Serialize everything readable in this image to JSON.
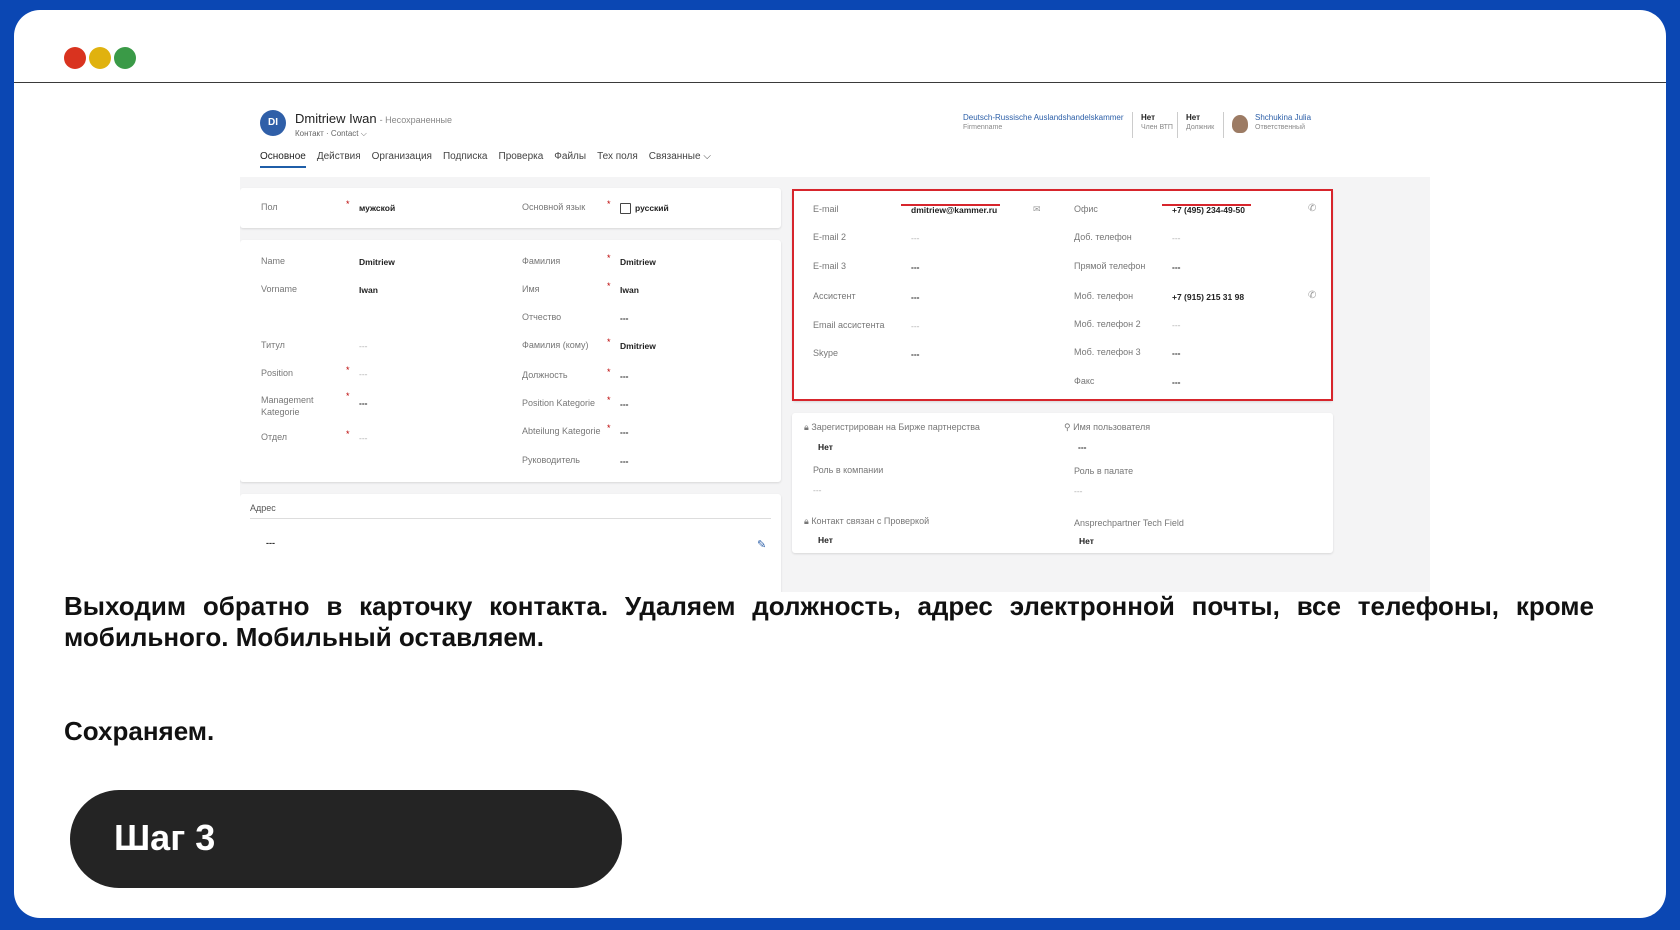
{
  "window": {
    "dots": [
      "#d9331f",
      "#e0b20f",
      "#3a9a47"
    ]
  },
  "record": {
    "initials": "DI",
    "name": "Dmitriew Iwan",
    "unsaved": "- Несохраненные",
    "subtitle": "Контакт · Contact ⌵",
    "header_fields": [
      {
        "value": "Deutsch-Russische Auslandshandelskammer",
        "label": "Firmenname"
      },
      {
        "value": "Нет",
        "label": "Член ВТП"
      },
      {
        "value": "Нет",
        "label": "Должник"
      },
      {
        "value": "Shchukina Julia",
        "label": "Ответственный"
      }
    ],
    "tabs": [
      "Основное",
      "Действия",
      "Организация",
      "Подписка",
      "Проверка",
      "Файлы",
      "Тех поля",
      "Связанные ⌵"
    ]
  },
  "general": [
    {
      "label": "Пол",
      "value": "мужской"
    },
    {
      "label": "Основной язык",
      "value": "русский"
    }
  ],
  "names_left": [
    {
      "label": "Name",
      "value": "Dmitriew"
    },
    {
      "label": "Vorname",
      "value": "Iwan"
    },
    {
      "label": "Титул",
      "value": "---"
    },
    {
      "label": "Position",
      "value": "---"
    },
    {
      "label": "Management Kategorie",
      "value": "---"
    },
    {
      "label": "Отдел",
      "value": "---"
    }
  ],
  "names_right": [
    {
      "label": "Фамилия",
      "value": "Dmitriew"
    },
    {
      "label": "Имя",
      "value": "Iwan"
    },
    {
      "label": "Отчество",
      "value": "---"
    },
    {
      "label": "Фамилия (кому)",
      "value": "Dmitriew"
    },
    {
      "label": "Должность",
      "value": "---"
    },
    {
      "label": "Position Kategorie",
      "value": "---"
    },
    {
      "label": "Abteilung Kategorie",
      "value": "---"
    },
    {
      "label": "Руководитель",
      "value": "---"
    }
  ],
  "address": {
    "title": "Адрес",
    "value": "---"
  },
  "contacts_left": [
    {
      "label": "E-mail",
      "value": "dmitriew@kammer.ru"
    },
    {
      "label": "E-mail 2",
      "value": "---"
    },
    {
      "label": "E-mail 3",
      "value": "---"
    },
    {
      "label": "Ассистент",
      "value": "---"
    },
    {
      "label": "Email ассистента",
      "value": "---"
    },
    {
      "label": "Skype",
      "value": "---"
    }
  ],
  "contacts_right": [
    {
      "label": "Офис",
      "value": "+7 (495) 234-49-50"
    },
    {
      "label": "Доб. телефон",
      "value": "---"
    },
    {
      "label": "Прямой телефон",
      "value": "---"
    },
    {
      "label": "Моб. телефон",
      "value": "+7 (915) 215 31 98"
    },
    {
      "label": "Моб. телефон 2",
      "value": "---"
    },
    {
      "label": "Моб. телефон 3",
      "value": "---"
    },
    {
      "label": "Факс",
      "value": "---"
    }
  ],
  "extra": [
    {
      "label": "Зарегистрирован на Бирже партнерства",
      "value": "Нет"
    },
    {
      "label": "Имя пользователя",
      "value": "---"
    },
    {
      "label": "Роль в компании",
      "value": "---"
    },
    {
      "label": "Роль в палате",
      "value": "---"
    },
    {
      "label": "Контакт связан с Проверкой",
      "value": "Нет"
    },
    {
      "label": "Ansprechpartner Tech Field",
      "value": "Нет"
    }
  ],
  "instruction": "Выходим обратно в карточку контакта. Удаляем должность, адрес электронной почты, все телефоны, кроме мобильного. Мобильный оставляем.",
  "save_text": "Сохраняем.",
  "step_label": "Шаг 3"
}
